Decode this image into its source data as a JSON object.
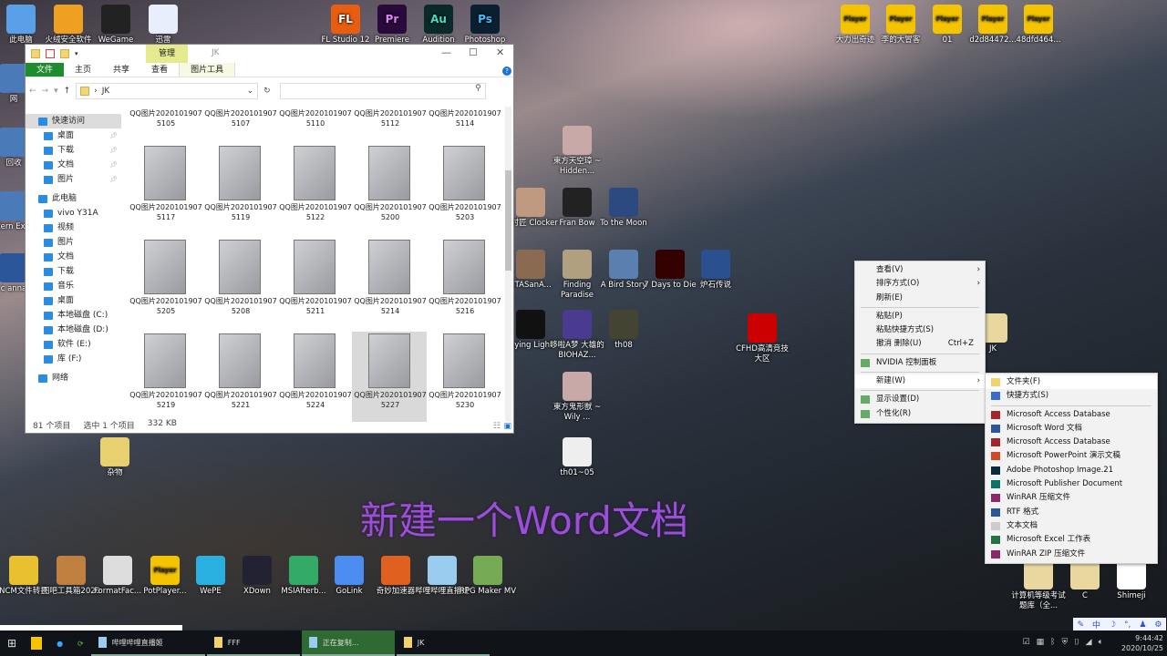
{
  "desktop": {
    "top_left": [
      {
        "label": "此电脑",
        "icon": "computer-icon"
      },
      {
        "label": "火绒安全软件",
        "icon": "huorong-icon"
      },
      {
        "label": "WeGame",
        "icon": "wegame-icon"
      },
      {
        "label": "迅雷",
        "icon": "xunlei-icon"
      }
    ],
    "top_apps": [
      {
        "label": "FL Studio 12",
        "glyph": "FL"
      },
      {
        "label": "Premiere",
        "glyph": "Pr"
      },
      {
        "label": "Audition",
        "glyph": "Au"
      },
      {
        "label": "Photoshop",
        "glyph": "Ps"
      }
    ],
    "left_partial": [
      "网",
      "回收",
      "Intern Explo",
      "c anna"
    ],
    "players": [
      {
        "label": "大力出奇迹",
        "glyph": "Player"
      },
      {
        "label": "李的大冒客",
        "glyph": "Player"
      },
      {
        "label": "01",
        "glyph": "Player"
      },
      {
        "label": "d2d84472...",
        "glyph": "Player"
      },
      {
        "label": "48dfd464...",
        "glyph": "Player"
      }
    ],
    "games": [
      "東方天空璋 ~ Hidden...",
      "钟时匠 Clocker",
      "Fran Bow",
      "To the Moon",
      "STASanA...",
      "Finding Paradise",
      "A Bird Story",
      "7 Days to Die",
      "炉石传说",
      "Dying Light",
      "哆啦A梦 大雄的BIOHAZ...",
      "th08",
      "CFHD高清竞技大区",
      "東方鬼形獣 ~ Wily ...",
      "th01~05",
      "JK"
    ],
    "misc": [
      "杂物"
    ],
    "bottom": [
      "NCM文件转换",
      "图吧工具箱2020",
      "FormatFac...",
      "PotPlayer...",
      "WePE",
      "XDown",
      "MSIAfterb...",
      "GoLink",
      "奇妙加速器",
      "哔哩哔哩直播姬",
      "RPG Maker MV"
    ],
    "bottom_right": [
      "计算机等级考试题库（全...",
      "C",
      "Shimeji"
    ]
  },
  "explorer": {
    "title": "JK",
    "context_tab": "管理",
    "context_subtab": "图片工具",
    "ribbon": [
      "文件",
      "主页",
      "共享",
      "查看"
    ],
    "address": "JK",
    "search_placeholder": "",
    "nav": [
      {
        "label": "快速访问",
        "lvl": 0,
        "sel": true
      },
      {
        "label": "桌面",
        "lvl": 1,
        "pin": true
      },
      {
        "label": "下载",
        "lvl": 1,
        "pin": true
      },
      {
        "label": "文档",
        "lvl": 1,
        "pin": true
      },
      {
        "label": "图片",
        "lvl": 1,
        "pin": true
      },
      {
        "label": "此电脑",
        "lvl": 0
      },
      {
        "label": "vivo Y31A",
        "lvl": 1
      },
      {
        "label": "视频",
        "lvl": 1
      },
      {
        "label": "图片",
        "lvl": 1
      },
      {
        "label": "文档",
        "lvl": 1
      },
      {
        "label": "下载",
        "lvl": 1
      },
      {
        "label": "音乐",
        "lvl": 1
      },
      {
        "label": "桌面",
        "lvl": 1
      },
      {
        "label": "本地磁盘 (C:)",
        "lvl": 1
      },
      {
        "label": "本地磁盘 (D:)",
        "lvl": 1
      },
      {
        "label": "软件 (E:)",
        "lvl": 1
      },
      {
        "label": "库 (F:)",
        "lvl": 1
      },
      {
        "label": "网络",
        "lvl": 0
      }
    ],
    "files": [
      "QQ图片20201019075105",
      "QQ图片20201019075107",
      "QQ图片20201019075110",
      "QQ图片20201019075112",
      "QQ图片20201019075114",
      "QQ图片20201019075117",
      "QQ图片20201019075119",
      "QQ图片20201019075122",
      "QQ图片20201019075200",
      "QQ图片20201019075203",
      "QQ图片20201019075205",
      "QQ图片20201019075208",
      "QQ图片20201019075211",
      "QQ图片20201019075214",
      "QQ图片20201019075216",
      "QQ图片20201019075219",
      "QQ图片20201019075221",
      "QQ图片20201019075224",
      "QQ图片20201019075227",
      "QQ图片20201019075230"
    ],
    "selected_file": "QQ图片20201019075227",
    "status": {
      "count": "81 个项目",
      "selected": "选中 1 个项目",
      "size": "332 KB"
    }
  },
  "context_menu": {
    "items": [
      {
        "label": "查看(V)",
        "arrow": true
      },
      {
        "label": "排序方式(O)",
        "arrow": true
      },
      {
        "label": "刷新(E)"
      },
      {
        "sep": true
      },
      {
        "label": "粘贴(P)"
      },
      {
        "label": "粘贴快捷方式(S)"
      },
      {
        "label": "撤消 删除(U)",
        "shortcut": "Ctrl+Z"
      },
      {
        "sep": true
      },
      {
        "label": "NVIDIA 控制面板",
        "icon": "nvidia-icon"
      },
      {
        "sep": true
      },
      {
        "label": "新建(W)",
        "arrow": true,
        "hl": true
      },
      {
        "sep": true
      },
      {
        "label": "显示设置(D)",
        "icon": "display-icon"
      },
      {
        "label": "个性化(R)",
        "icon": "personalize-icon"
      }
    ]
  },
  "new_submenu": {
    "items": [
      {
        "label": "文件夹(F)",
        "icon": "folder-icon",
        "color": "#f3d26b",
        "hl": true
      },
      {
        "label": "快捷方式(S)",
        "icon": "shortcut-icon",
        "color": "#3a6bc9"
      },
      {
        "sep": true
      },
      {
        "label": "Microsoft Access Database",
        "icon": "access-icon",
        "color": "#a4262c"
      },
      {
        "label": "Microsoft Word 文档",
        "icon": "word-icon",
        "color": "#2b579a"
      },
      {
        "label": "Microsoft Access Database",
        "icon": "access-icon",
        "color": "#a4262c"
      },
      {
        "label": "Microsoft PowerPoint 演示文稿",
        "icon": "powerpoint-icon",
        "color": "#d24726"
      },
      {
        "label": "Adobe Photoshop Image.21",
        "icon": "photoshop-icon",
        "color": "#0a2a40"
      },
      {
        "label": "Microsoft Publisher Document",
        "icon": "publisher-icon",
        "color": "#077568"
      },
      {
        "label": "WinRAR 压缩文件",
        "icon": "winrar-icon",
        "color": "#8b2a6a"
      },
      {
        "label": "RTF 格式",
        "icon": "rtf-icon",
        "color": "#2b579a"
      },
      {
        "label": "文本文档",
        "icon": "text-icon",
        "color": "#cccccc"
      },
      {
        "label": "Microsoft Excel 工作表",
        "icon": "excel-icon",
        "color": "#217346"
      },
      {
        "label": "WinRAR ZIP 压缩文件",
        "icon": "winrar-zip-icon",
        "color": "#8b2a6a"
      }
    ]
  },
  "subtitle": "新建一个Word文档",
  "taskbar": {
    "items": [
      {
        "label": "哔哩哔哩直播姬",
        "icon": "bilibili-icon"
      },
      {
        "label": "FFF",
        "icon": "folder-icon"
      },
      {
        "label": "正在复制...",
        "icon": "copy-icon",
        "active": true
      },
      {
        "label": "JK",
        "icon": "folder-icon"
      }
    ],
    "time": "9:44:42",
    "date": "2020/10/25"
  },
  "ime": [
    "中",
    "☽",
    "°,",
    "♟",
    "⚙"
  ]
}
